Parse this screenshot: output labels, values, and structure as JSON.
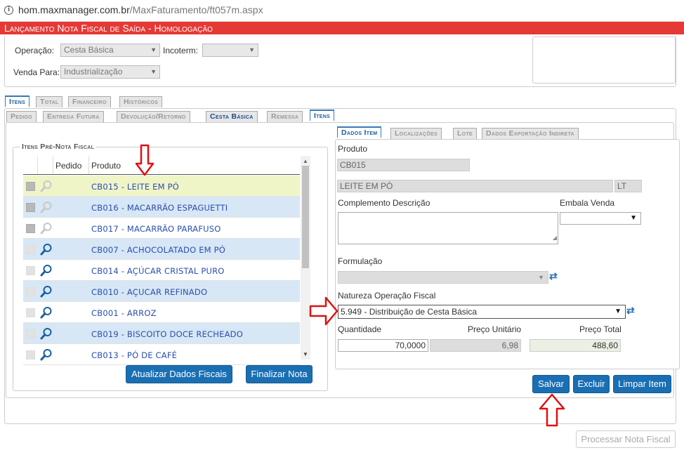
{
  "browser": {
    "url_host": "hom.maxmanager.com.br",
    "url_path": "/MaxFaturamento/ft057m.aspx"
  },
  "title": "Lançamento Nota Fiscal de Saída  - Homologação",
  "header_form": {
    "operacao_label": "Operação:",
    "operacao_value": "Cesta Básica",
    "incoterm_label": "Incoterm:",
    "incoterm_value": "",
    "venda_para_label": "Venda Para:",
    "venda_para_value": "Industrialização"
  },
  "main_tabs": [
    "Itens",
    "Total",
    "Financeiro",
    "Históricos"
  ],
  "sub_tabs": [
    "Pedido",
    "Entrega Futura",
    "Devolução/Retorno",
    "Cesta Básica",
    "Remessa",
    "Itens"
  ],
  "items_panel": {
    "legend": "Itens Pré-Nota Fiscal",
    "col_pedido": "Pedido",
    "col_produto": "Produto",
    "rows": [
      {
        "produto": "CB015 - LEITE EM PÓ"
      },
      {
        "produto": "CB016 - MACARRÃO ESPAGUETTI"
      },
      {
        "produto": "CB017 - MACARRÃO PARAFUSO"
      },
      {
        "produto": "CB007 - ACHOCOLATADO EM PÓ"
      },
      {
        "produto": "CB014 - AÇÚCAR CRISTAL PURO"
      },
      {
        "produto": "CB010 - AÇUCAR REFINADO"
      },
      {
        "produto": "CB001 - ARROZ"
      },
      {
        "produto": "CB019 - BISCOITO DOCE RECHEADO"
      },
      {
        "produto": "CB013 - PÓ DE CAFÉ"
      }
    ],
    "btn_atualizar": "Atualizar Dados Fiscais",
    "btn_finalizar": "Finalizar Nota"
  },
  "detail_tabs": [
    "Dados Item",
    "Localizações",
    "Lote",
    "Dados Exportação Indireta"
  ],
  "detail": {
    "produto_label": "Produto",
    "produto_code": "CB015",
    "produto_desc": "LEITE EM PÓ",
    "produto_un": "LT",
    "complemento_label": "Complemento Descrição",
    "embala_label": "Embala Venda",
    "formulacao_label": "Formulação",
    "natureza_label": "Natureza Operação Fiscal",
    "natureza_value": "5.949 - Distribuição de Cesta Básica",
    "quantidade_label": "Quantidade",
    "quantidade_value": "70,0000",
    "preco_unit_label": "Preço Unitário",
    "preco_unit_value": "6,98",
    "preco_total_label": "Preço Total",
    "preco_total_value": "488,60"
  },
  "buttons": {
    "salvar": "Salvar",
    "excluir": "Excluir",
    "limpar": "Limpar Item",
    "processar": "Processar Nota Fiscal"
  }
}
